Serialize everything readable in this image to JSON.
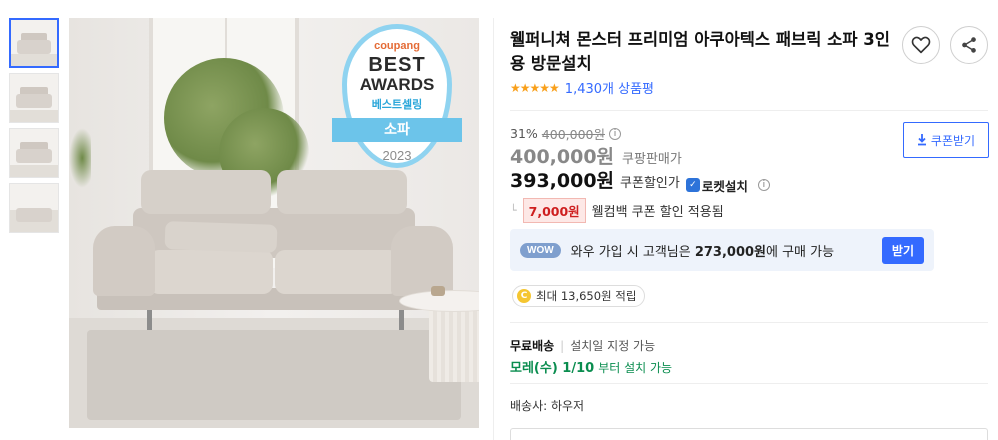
{
  "gallery": {
    "thumbnails": [
      "thumb-1",
      "thumb-2",
      "thumb-3",
      "thumb-4"
    ],
    "selected_index": 0,
    "badge": {
      "brand": "coupang",
      "line1": "BEST",
      "line2": "AWARDS",
      "sub": "베스트셀링",
      "category": "소파",
      "year": "2023"
    }
  },
  "product": {
    "title": "웰퍼니쳐 몬스터 프리미엄 아쿠아텍스 패브릭 소파 3인용 방문설치",
    "rating_stars": 5,
    "review_count": "1,430개 상품평",
    "wishlist_icon": "heart-icon",
    "share_icon": "share-icon"
  },
  "pricing": {
    "discount_rate": "31%",
    "original_price": "400,000원",
    "coupon_button": "쿠폰받기",
    "sale_price": "400,000원",
    "sale_label": "쿠팡판매가",
    "coupon_price": "393,000원",
    "coupon_label": "쿠폰할인가",
    "delivery_badge": "로켓설치",
    "coupon_amount": "7,000원",
    "coupon_desc": "웰컴백 쿠폰 할인 적용됨"
  },
  "wow": {
    "tag": "WOW",
    "text_prefix": "와우 가입 시 고객님은 ",
    "text_price": "273,000원",
    "text_suffix": "에 구매 가능",
    "button": "받기"
  },
  "points": {
    "coin": "C",
    "text": "최대 13,650원 적립"
  },
  "shipping": {
    "free_label": "무료배송",
    "install_note": "설치일 지정 가능",
    "date": "모레(수) 1/10",
    "date_suffix": "부터 설치 가능"
  },
  "seller": {
    "text": "배송사: 하우저"
  },
  "colors": {
    "accent": "#346aff",
    "star": "#f9a01b",
    "coupon_red": "#ce1f1f",
    "arrival_green": "#0a8d4f"
  }
}
